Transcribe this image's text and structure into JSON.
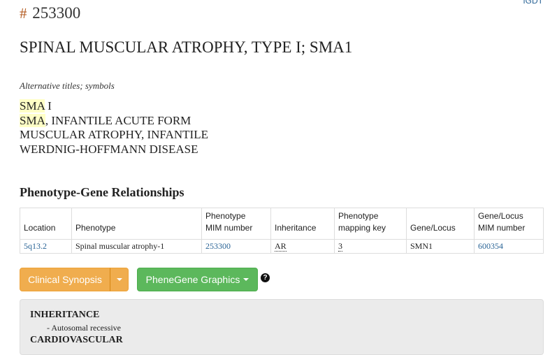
{
  "top_link": "IGDT",
  "entry": {
    "hash": "#",
    "mim_number": "253300"
  },
  "title": "SPINAL MUSCULAR ATROPHY, TYPE I; SMA1",
  "alternative_titles": {
    "caption": "Alternative titles; symbols",
    "items": [
      {
        "highlight": "SMA",
        "rest": " I"
      },
      {
        "highlight": "SMA",
        "rest": ", INFANTILE ACUTE FORM"
      },
      {
        "highlight": "",
        "rest": "MUSCULAR ATROPHY, INFANTILE"
      },
      {
        "highlight": "",
        "rest": "WERDNIG-HOFFMANN DISEASE"
      }
    ]
  },
  "phenotype_gene": {
    "heading": "Phenotype-Gene Relationships",
    "columns": [
      "Location",
      "Phenotype",
      "Phenotype\nMIM number",
      "Inheritance",
      "Phenotype\nmapping key",
      "Gene/Locus",
      "Gene/Locus\nMIM number"
    ],
    "rows": [
      {
        "location": "5q13.2",
        "phenotype": "Spinal muscular atrophy-1",
        "phenotype_mim": "253300",
        "inheritance": "AR",
        "mapping_key": "3",
        "gene": "SMN1",
        "gene_mim": "600354"
      }
    ]
  },
  "buttons": {
    "clinical_synopsis": "Clinical Synopsis",
    "phenegene": "PheneGene Graphics",
    "help": "?"
  },
  "synopsis": {
    "sections": [
      {
        "heading": "INHERITANCE",
        "items": [
          "- Autosomal recessive"
        ]
      },
      {
        "heading": "CARDIOVASCULAR",
        "items": []
      }
    ]
  },
  "colors": {
    "link": "#2a6496",
    "orange": "#f0ad4e",
    "green": "#5cb85c",
    "highlight": "#ffffc6"
  }
}
